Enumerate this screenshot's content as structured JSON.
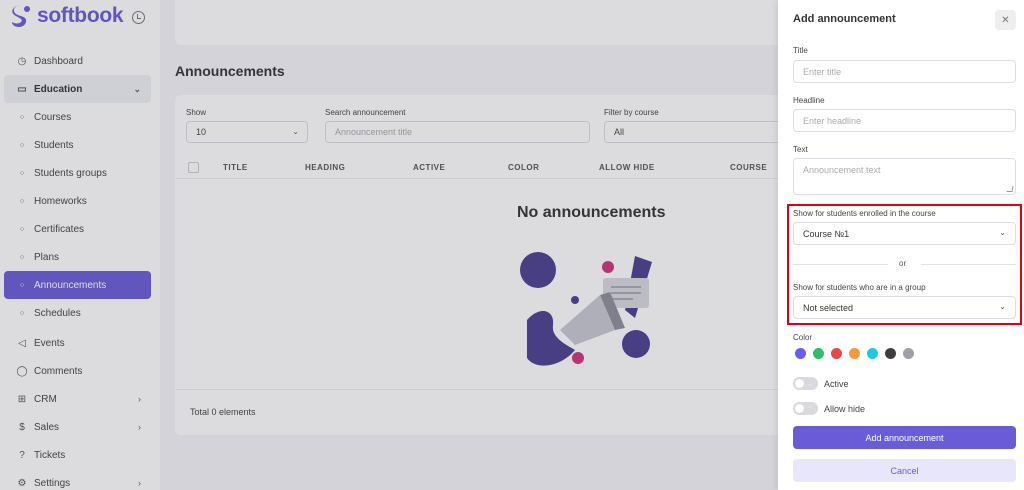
{
  "brand": {
    "name": "softbook",
    "accent": "#6a5cd6"
  },
  "sidebar": {
    "items": [
      {
        "label": "Dashboard",
        "icon": "gauge-icon"
      },
      {
        "label": "Education",
        "icon": "book-icon"
      },
      {
        "label": "Courses",
        "icon": "circle-icon"
      },
      {
        "label": "Students",
        "icon": "circle-icon"
      },
      {
        "label": "Students groups",
        "icon": "circle-icon"
      },
      {
        "label": "Homeworks",
        "icon": "circle-icon"
      },
      {
        "label": "Certificates",
        "icon": "circle-icon"
      },
      {
        "label": "Plans",
        "icon": "circle-icon"
      },
      {
        "label": "Announcements",
        "icon": "circle-icon"
      },
      {
        "label": "Schedules",
        "icon": "circle-icon"
      },
      {
        "label": "Events",
        "icon": "megaphone-icon"
      },
      {
        "label": "Comments",
        "icon": "comment-icon"
      },
      {
        "label": "CRM",
        "icon": "grid-icon"
      },
      {
        "label": "Sales",
        "icon": "dollar-icon"
      },
      {
        "label": "Tickets",
        "icon": "question-icon"
      },
      {
        "label": "Settings",
        "icon": "gear-icon"
      }
    ],
    "active_item": "Announcements",
    "expanded_group": "Education"
  },
  "main": {
    "title": "Announcements",
    "filters": {
      "show_label": "Show",
      "show_value": "10",
      "search_label": "Search announcement",
      "search_placeholder": "Announcement title",
      "course_label": "Filter by course",
      "course_value": "All"
    },
    "columns": [
      "TITLE",
      "HEADING",
      "ACTIVE",
      "COLOR",
      "ALLOW HIDE",
      "COURSE"
    ],
    "empty_text": "No announcements",
    "total_text": "Total 0 elements"
  },
  "drawer": {
    "title": "Add announcement",
    "title_label": "Title",
    "title_placeholder": "Enter title",
    "headline_label": "Headline",
    "headline_placeholder": "Enter headline",
    "text_label": "Text",
    "text_placeholder": "Announcement text",
    "course_label": "Show for students enrolled in the course",
    "course_value": "Course №1",
    "or_text": "or",
    "group_label": "Show for students who are in a group",
    "group_value": "Not selected",
    "color_label": "Color",
    "colors": [
      "#6a5cf0",
      "#2ebd6b",
      "#e84848",
      "#f59a3a",
      "#1ec8e0",
      "#3d3d3d",
      "#a0a0a8"
    ],
    "active_label": "Active",
    "allow_hide_label": "Allow hide",
    "submit_label": "Add announcement",
    "cancel_label": "Cancel"
  }
}
